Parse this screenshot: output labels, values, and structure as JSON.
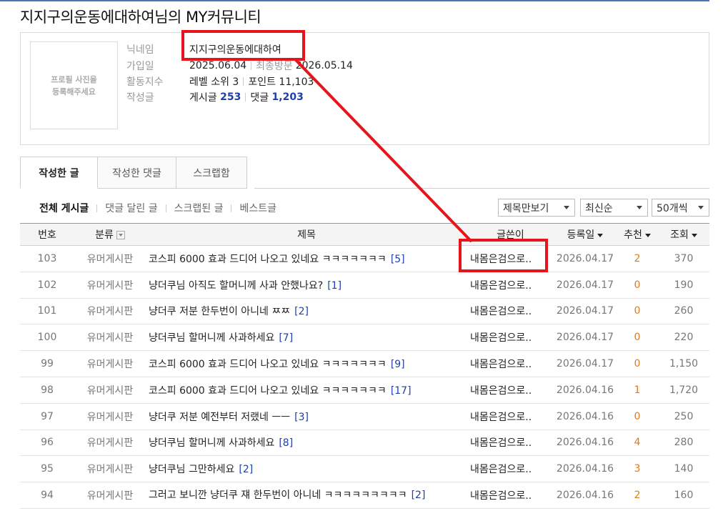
{
  "page": {
    "title": "지지구의운동에대하여님의 MY커뮤니티"
  },
  "profile": {
    "photo_placeholder": "프로필 사진을\n등록해주세요",
    "nickname_label": "닉네임",
    "nickname": "지지구의운동에대하여",
    "joined_label": "가입일",
    "joined": "2025.06.04",
    "last_visit_label": "최종방문",
    "last_visit": "2026.05.14",
    "activity_label": "활동지수",
    "level": "레벨 소위 3",
    "points": "포인트 11,103",
    "posts_label": "작성글",
    "posts_text": "게시글",
    "posts_count": "253",
    "comments_text": "댓글",
    "comments_count": "1,203"
  },
  "tabs": [
    {
      "label": "작성한 글",
      "active": true
    },
    {
      "label": "작성한 댓글",
      "active": false
    },
    {
      "label": "스크랩함",
      "active": false
    }
  ],
  "subnav": [
    {
      "label": "전체 게시글",
      "active": true
    },
    {
      "label": "댓글 달린 글",
      "active": false
    },
    {
      "label": "스크랩된 글",
      "active": false
    },
    {
      "label": "베스트글",
      "active": false
    }
  ],
  "filters": {
    "view_mode": "제목만보기",
    "sort": "최신순",
    "page_size": "50개씩"
  },
  "table": {
    "headers": {
      "num": "번호",
      "category": "분류",
      "title": "제목",
      "author": "글쓴이",
      "date": "등록일",
      "rec": "추천",
      "views": "조회"
    },
    "rows": [
      {
        "num": "103",
        "category": "유머게시판",
        "title": "코스피 6000 효과 드디어 나오고 있네요 ㅋㅋㅋㅋㅋㅋㅋ",
        "comments": "[5]",
        "author": "내몸은검으로..",
        "date": "2026.04.17",
        "rec": "2",
        "views": "370"
      },
      {
        "num": "102",
        "category": "유머게시판",
        "title": "냥더쿠님 아직도 할머니께 사과 안했나요?",
        "comments": "[1]",
        "author": "내몸은검으로..",
        "date": "2026.04.17",
        "rec": "0",
        "views": "190"
      },
      {
        "num": "101",
        "category": "유머게시판",
        "title": "냥더쿠 저분 한두번이 아니네 ㅉㅉ",
        "comments": "[2]",
        "author": "내몸은검으로..",
        "date": "2026.04.17",
        "rec": "0",
        "views": "260"
      },
      {
        "num": "100",
        "category": "유머게시판",
        "title": "냥더쿠님 할머니께 사과하세요",
        "comments": "[7]",
        "author": "내몸은검으로..",
        "date": "2026.04.17",
        "rec": "0",
        "views": "220"
      },
      {
        "num": "99",
        "category": "유머게시판",
        "title": "코스피 6000 효과 드디어 나오고 있네요 ㅋㅋㅋㅋㅋㅋㅋ",
        "comments": "[9]",
        "author": "내몸은검으로..",
        "date": "2026.04.17",
        "rec": "0",
        "views": "1,150"
      },
      {
        "num": "98",
        "category": "유머게시판",
        "title": "코스피 6000 효과 드디어 나오고 있네요 ㅋㅋㅋㅋㅋㅋㅋ",
        "comments": "[17]",
        "author": "내몸은검으로..",
        "date": "2026.04.16",
        "rec": "1",
        "views": "1,720"
      },
      {
        "num": "97",
        "category": "유머게시판",
        "title": "냥더쿠 저분 예전부터 저랬네 ㅡㅡ",
        "comments": "[3]",
        "author": "내몸은검으로..",
        "date": "2026.04.16",
        "rec": "0",
        "views": "250"
      },
      {
        "num": "96",
        "category": "유머게시판",
        "title": "냥더쿠님 할머니께 사과하세요",
        "comments": "[8]",
        "author": "내몸은검으로..",
        "date": "2026.04.16",
        "rec": "4",
        "views": "280"
      },
      {
        "num": "95",
        "category": "유머게시판",
        "title": "냥더쿠님 그만하세요",
        "comments": "[2]",
        "author": "내몸은검으로..",
        "date": "2026.04.16",
        "rec": "3",
        "views": "140"
      },
      {
        "num": "94",
        "category": "유머게시판",
        "title": "그러고 보니깐 냥더쿠 쟤 한두번이 아니네 ㅋㅋㅋㅋㅋㅋㅋㅋㅋ",
        "comments": "[2]",
        "author": "내몸은검으로..",
        "date": "2026.04.16",
        "rec": "2",
        "views": "160"
      }
    ]
  },
  "colors": {
    "annotation": "#e8141c",
    "link": "#1f3fa8",
    "recommend": "#e07b1a"
  }
}
